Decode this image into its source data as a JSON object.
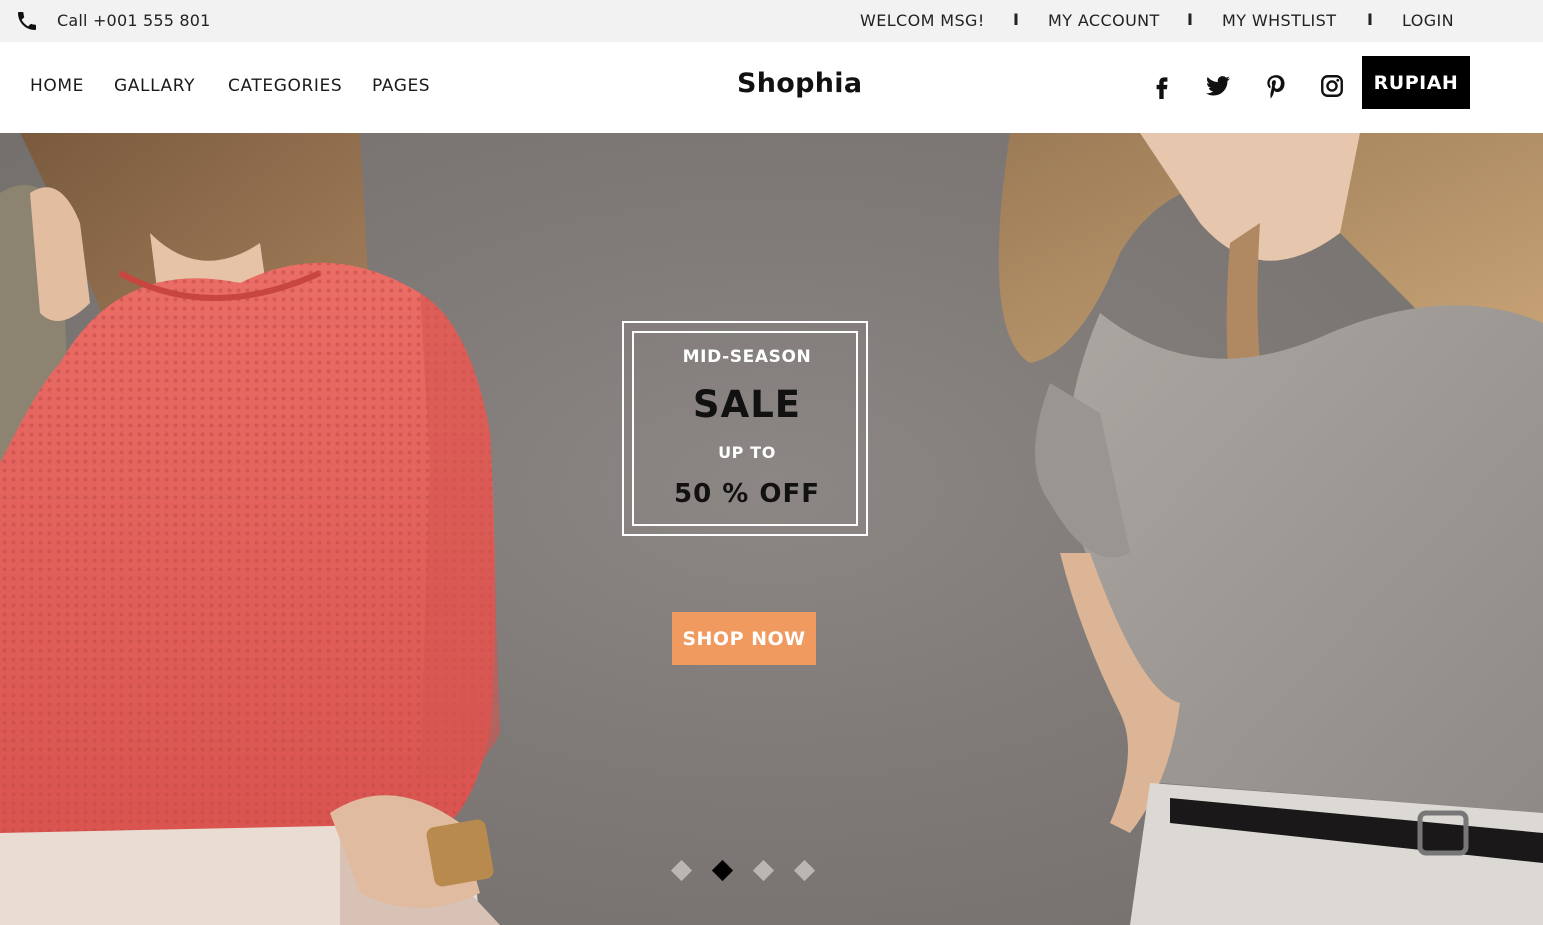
{
  "topbar": {
    "phone_icon": "phone-icon",
    "phone_text": "Call +001 555 801",
    "links": [
      "WELCOM MSG!",
      "MY ACCOUNT",
      "MY WHSTLIST",
      "LOGIN"
    ],
    "separator": "I"
  },
  "header": {
    "nav": [
      "HOME",
      "GALLARY",
      "CATEGORIES",
      "PAGES"
    ],
    "logo": "Shophia",
    "social_icons": [
      "facebook-icon",
      "twitter-icon",
      "pinterest-icon",
      "instagram-icon"
    ],
    "currency_label": "RUPIAH"
  },
  "hero": {
    "promo_line1": "MID-SEASON",
    "promo_line2": "SALE",
    "promo_line3": "UP TO",
    "promo_line4": "50 % OFF",
    "cta_label": "SHOP NOW",
    "slide_count": 4,
    "active_slide": 2
  },
  "colors": {
    "topbar_bg": "#f2f2f2",
    "cta_bg": "#f09a5f",
    "currency_bg": "#000000",
    "hero_bg": "#8a8582",
    "sweater": "#e8645f",
    "tshirt": "#a6a19c"
  }
}
